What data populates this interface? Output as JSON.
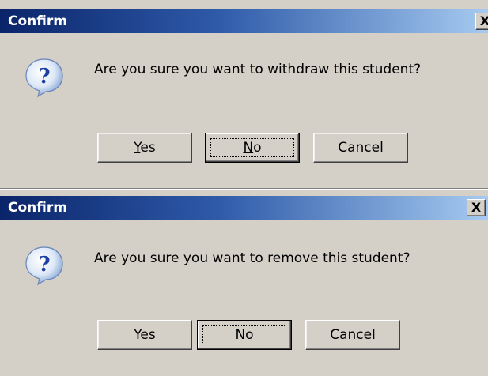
{
  "dialogs": [
    {
      "title": "Confirm",
      "close_label": "X",
      "icon": "question-icon",
      "message": "Are you sure you want to withdraw this student?",
      "buttons": {
        "yes": {
          "mnemonic": "Y",
          "rest": "es"
        },
        "no": {
          "mnemonic": "N",
          "rest": "o"
        },
        "cancel": {
          "label": "Cancel"
        }
      }
    },
    {
      "title": "Confirm",
      "close_label": "X",
      "icon": "question-icon",
      "message": "Are you sure you want to remove this student?",
      "buttons": {
        "yes": {
          "mnemonic": "Y",
          "rest": "es"
        },
        "no": {
          "mnemonic": "N",
          "rest": "o"
        },
        "cancel": {
          "label": "Cancel"
        }
      }
    }
  ],
  "colors": {
    "titlebar_start": "#0a246a",
    "titlebar_end": "#a6caf0",
    "face": "#d4d0c8"
  }
}
